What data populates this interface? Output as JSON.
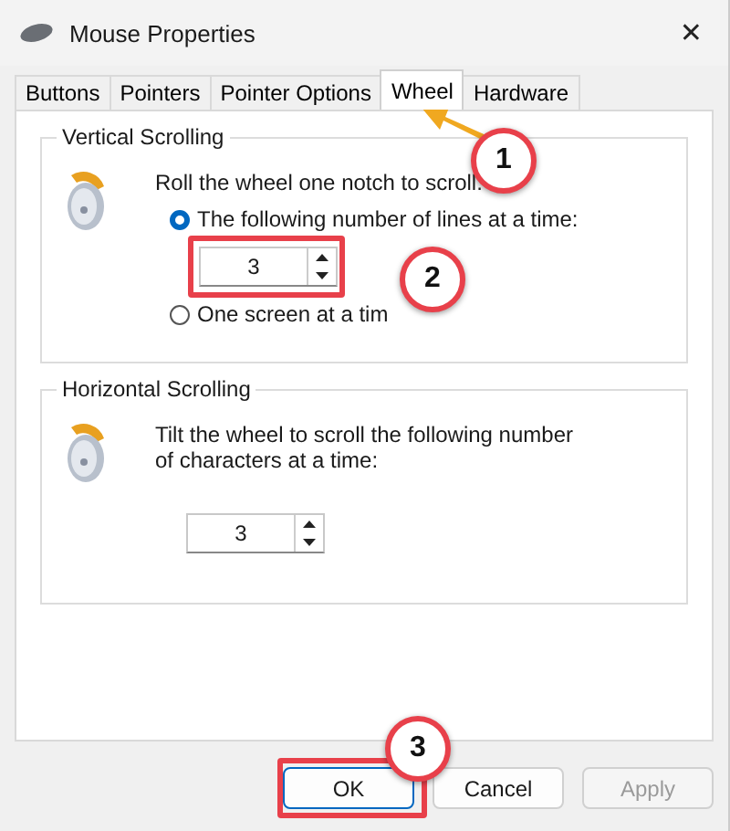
{
  "window": {
    "title": "Mouse Properties",
    "close": "✕"
  },
  "tabs": [
    {
      "label": "Buttons",
      "selected": false
    },
    {
      "label": "Pointers",
      "selected": false
    },
    {
      "label": "Pointer Options",
      "selected": false
    },
    {
      "label": "Wheel",
      "selected": true
    },
    {
      "label": "Hardware",
      "selected": false
    }
  ],
  "vertical_scrolling": {
    "title": "Vertical Scrolling",
    "prompt": "Roll the wheel one notch to scroll:",
    "options": [
      {
        "label": "The following number of lines at a time:",
        "selected": true
      },
      {
        "label": "One screen at a tim",
        "selected": false
      }
    ],
    "lines": "3"
  },
  "horizontal_scrolling": {
    "title": "Horizontal Scrolling",
    "prompt": "Tilt the wheel to scroll the following number of characters at a time:",
    "characters": "3"
  },
  "buttons": [
    {
      "label": "OK",
      "disabled": false
    },
    {
      "label": "Cancel",
      "disabled": false
    },
    {
      "label": "Apply",
      "disabled": true
    }
  ],
  "annotations": [
    {
      "label": "1"
    },
    {
      "label": "2"
    },
    {
      "label": "3"
    }
  ]
}
